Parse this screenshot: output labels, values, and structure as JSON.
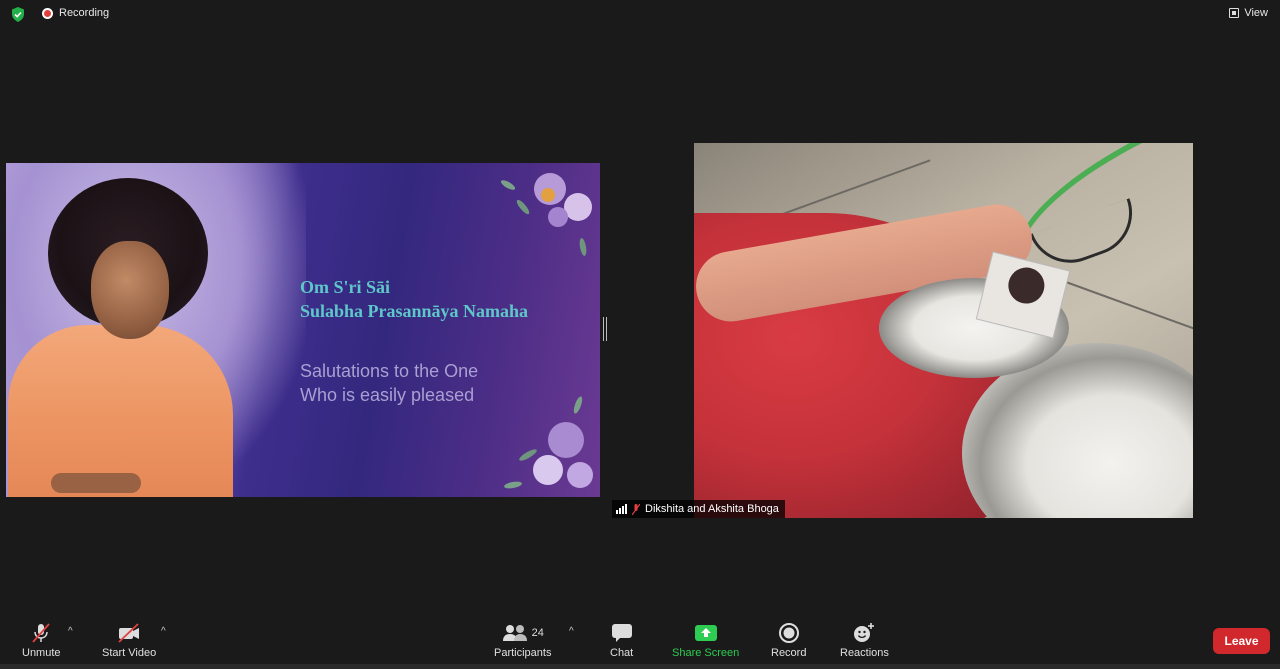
{
  "topbar": {
    "recording_label": "Recording",
    "view_label": "View"
  },
  "slide": {
    "title_line1": "Om S'ri Sāi",
    "title_line2": "Sulabha Prasannāya Namaha",
    "subtitle_line1": "Salutations to the One",
    "subtitle_line2": "Who is easily pleased"
  },
  "video": {
    "participant_name": "Dikshita and Akshita  Bhoga"
  },
  "toolbar": {
    "unmute_label": "Unmute",
    "start_video_label": "Start Video",
    "participants_label": "Participants",
    "participants_count": "24",
    "chat_label": "Chat",
    "share_screen_label": "Share Screen",
    "record_label": "Record",
    "reactions_label": "Reactions",
    "leave_label": "Leave"
  },
  "colors": {
    "background": "#1a1a1a",
    "share_green": "#2ecc52",
    "leave_red": "#d0282c",
    "slide_title": "#5fc6c9",
    "slide_subtitle": "#a99fd2"
  },
  "icons": {
    "security": "shield-check-icon",
    "recording": "record-dot-icon",
    "view": "view-grid-icon",
    "mic": "mic-muted-icon",
    "video": "video-off-icon",
    "participants": "people-icon",
    "chat": "chat-bubble-icon",
    "share": "share-screen-icon",
    "record": "record-icon",
    "reactions": "smiley-plus-icon"
  }
}
